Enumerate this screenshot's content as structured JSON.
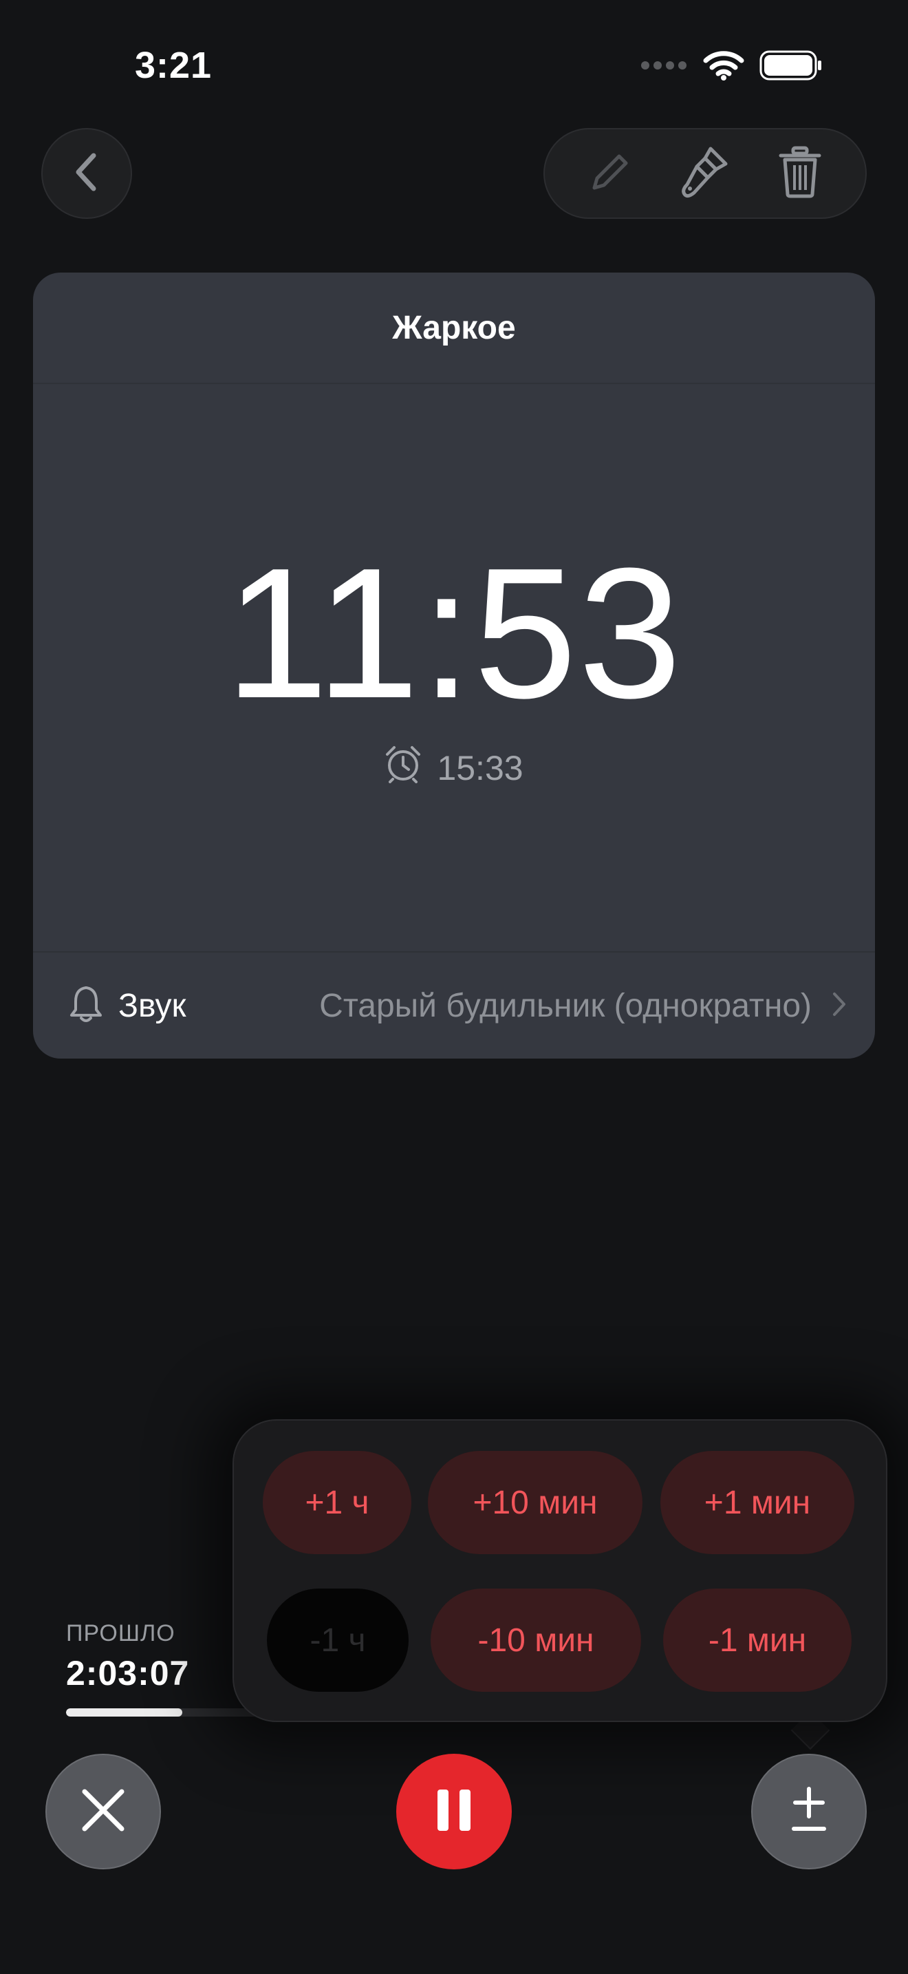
{
  "status_bar": {
    "time": "3:21",
    "icons": [
      "signal-dots-icon",
      "wifi-icon",
      "battery-icon"
    ]
  },
  "toolbar": {
    "back_icon": "chevron-left-icon",
    "tools": [
      "pencil-icon",
      "paintbrush-icon",
      "trash-icon"
    ]
  },
  "timer_card": {
    "title": "Жаркое",
    "remaining": "11:53",
    "alarm_time": "15:33",
    "sound_label": "Звук",
    "sound_value": "Старый будильник (однократно)"
  },
  "elapsed": {
    "label": "ПРОШЛО",
    "value": "2:03:07",
    "progress": 0.15
  },
  "adjust_popover": {
    "row1": [
      "+1 ч",
      "+10 мин",
      "+1 мин"
    ],
    "row2": [
      "-1 ч",
      "-10 мин",
      "-1 мин"
    ]
  },
  "controls": {
    "cancel_icon": "close-icon",
    "pause_icon": "pause-icon",
    "adjust_icon": "plus-minus-icon"
  },
  "colors": {
    "background": "#131416",
    "card": "#353840",
    "accent_red": "#e5262c",
    "adjust_text": "#f2555a",
    "adjust_bg": "#3a1b1d"
  }
}
